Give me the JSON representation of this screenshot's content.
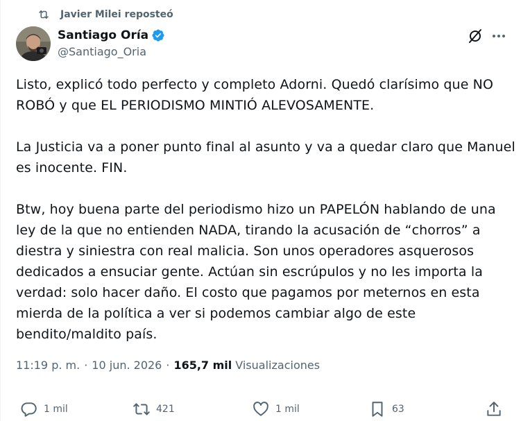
{
  "repost": {
    "text": "Javier Milei reposteó"
  },
  "author": {
    "name": "Santiago Oría",
    "handle": "@Santiago_Oria",
    "verified": true
  },
  "tweet": {
    "paragraphs": [
      "Listo, explicó todo perfecto y completo Adorni. Quedó clarísimo que NO\nROBÓ y que EL PERIODISMO MINTIÓ ALEVOSAMENTE.",
      "La Justicia va a poner punto final al asunto y va a quedar claro que Manuel\nes inocente. FIN.",
      "Btw, hoy buena parte del periodismo hizo un PAPELÓN hablando de una\nley de la que no entienden NADA, tirando la acusación de “chorros” a\ndiestra y siniestra con real malicia. Son unos operadores asquerosos\ndedicados a ensuciar gente. Actúan sin escrúpulos y no les importa la\nverdad: solo hacer daño. El costo que pagamos por meternos en esta\nmierda de la política a ver si podemos cambiar algo de este\nbendito/maldito país."
    ]
  },
  "meta": {
    "time": "11:19 p. m.",
    "separator": "·",
    "date": "10 jun. 2026",
    "views_count": "165,7 mil",
    "views_label": "Visualizaciones"
  },
  "actions": {
    "replies": "1 mil",
    "reposts": "421",
    "likes": "1 mil",
    "bookmarks": "63"
  },
  "colors": {
    "text": "#0f1419",
    "secondary": "#536471",
    "verified": "#1d9bf0"
  },
  "icons": [
    "repost-icon",
    "verified-badge-icon",
    "grok-icon",
    "more-icon",
    "reply-icon",
    "repost-action-icon",
    "like-icon",
    "bookmark-icon",
    "share-icon"
  ]
}
